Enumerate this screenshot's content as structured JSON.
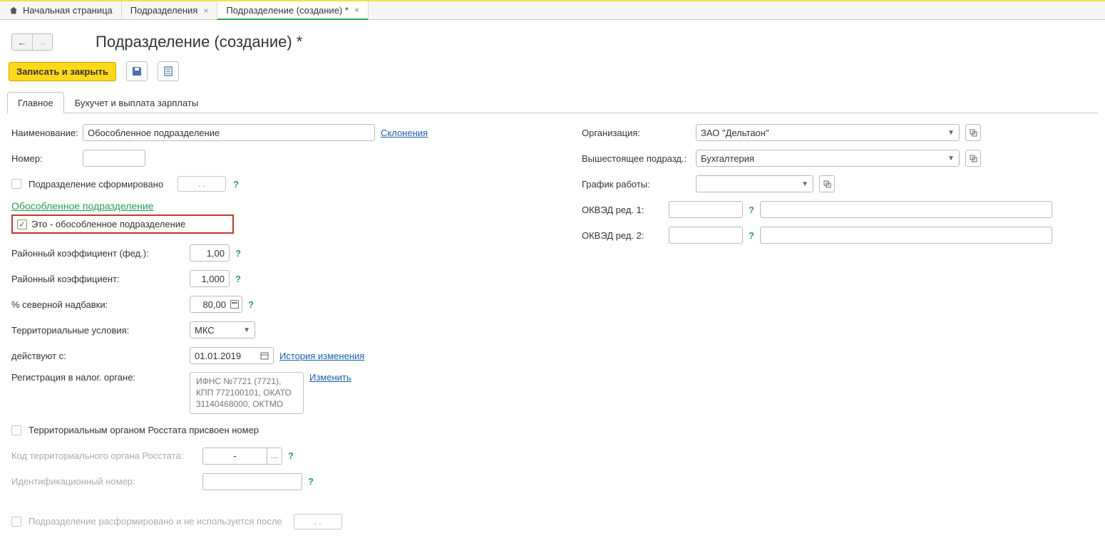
{
  "topTabs": {
    "home": "Начальная страница",
    "t1": "Подразделения",
    "t2": "Подразделение (создание) *"
  },
  "pageTitle": "Подразделение (создание) *",
  "toolbar": {
    "save_close": "Записать и закрыть"
  },
  "formTabs": {
    "main": "Главное",
    "acc": "Бухучет и выплата зарплаты"
  },
  "left": {
    "name_lbl": "Наименование:",
    "name_val": "Обособленное подразделение",
    "declensions": "Склонения",
    "num_lbl": "Номер:",
    "num_val": "",
    "formed_lbl": "Подразделение сформировано",
    "formed_date": ". .",
    "section": "Обособленное подразделение",
    "is_sep": "Это - обособленное подразделение",
    "coef_fed_lbl": "Районный коэффициент (фед.):",
    "coef_fed_val": "1,00",
    "coef_lbl": "Районный коэффициент:",
    "coef_val": "1,000",
    "north_lbl": "% северной надбавки:",
    "north_val": "80,00",
    "terr_lbl": "Территориальные условия:",
    "terr_val": "МКС",
    "valid_lbl": "действуют с:",
    "valid_val": "01.01.2019",
    "history": "История изменения",
    "reg_lbl": "Регистрация в налог. органе:",
    "reg_val": "ИФНС №7721 (7721), КПП 772100101, ОКАТО 31140468000, ОКТМО",
    "change": "Изменить",
    "rosstat_chk": "Территориальным органом Росстата присвоен номер",
    "rosstat_code_lbl": "Код территориального органа Росстата:",
    "rosstat_code_val": "-",
    "ident_lbl": "Идентификационный номер:",
    "ident_val": "",
    "disband_lbl": "Подразделение расформировано и не используется после",
    "disband_date": ". ."
  },
  "right": {
    "org_lbl": "Организация:",
    "org_val": "ЗАО \"Дельтаон\"",
    "parent_lbl": "Вышестоящее подразд.:",
    "parent_val": "Бухгалтерия",
    "sched_lbl": "График работы:",
    "sched_val": "",
    "okved1_lbl": "ОКВЭД ред. 1:",
    "okved2_lbl": "ОКВЭД ред. 2:"
  }
}
